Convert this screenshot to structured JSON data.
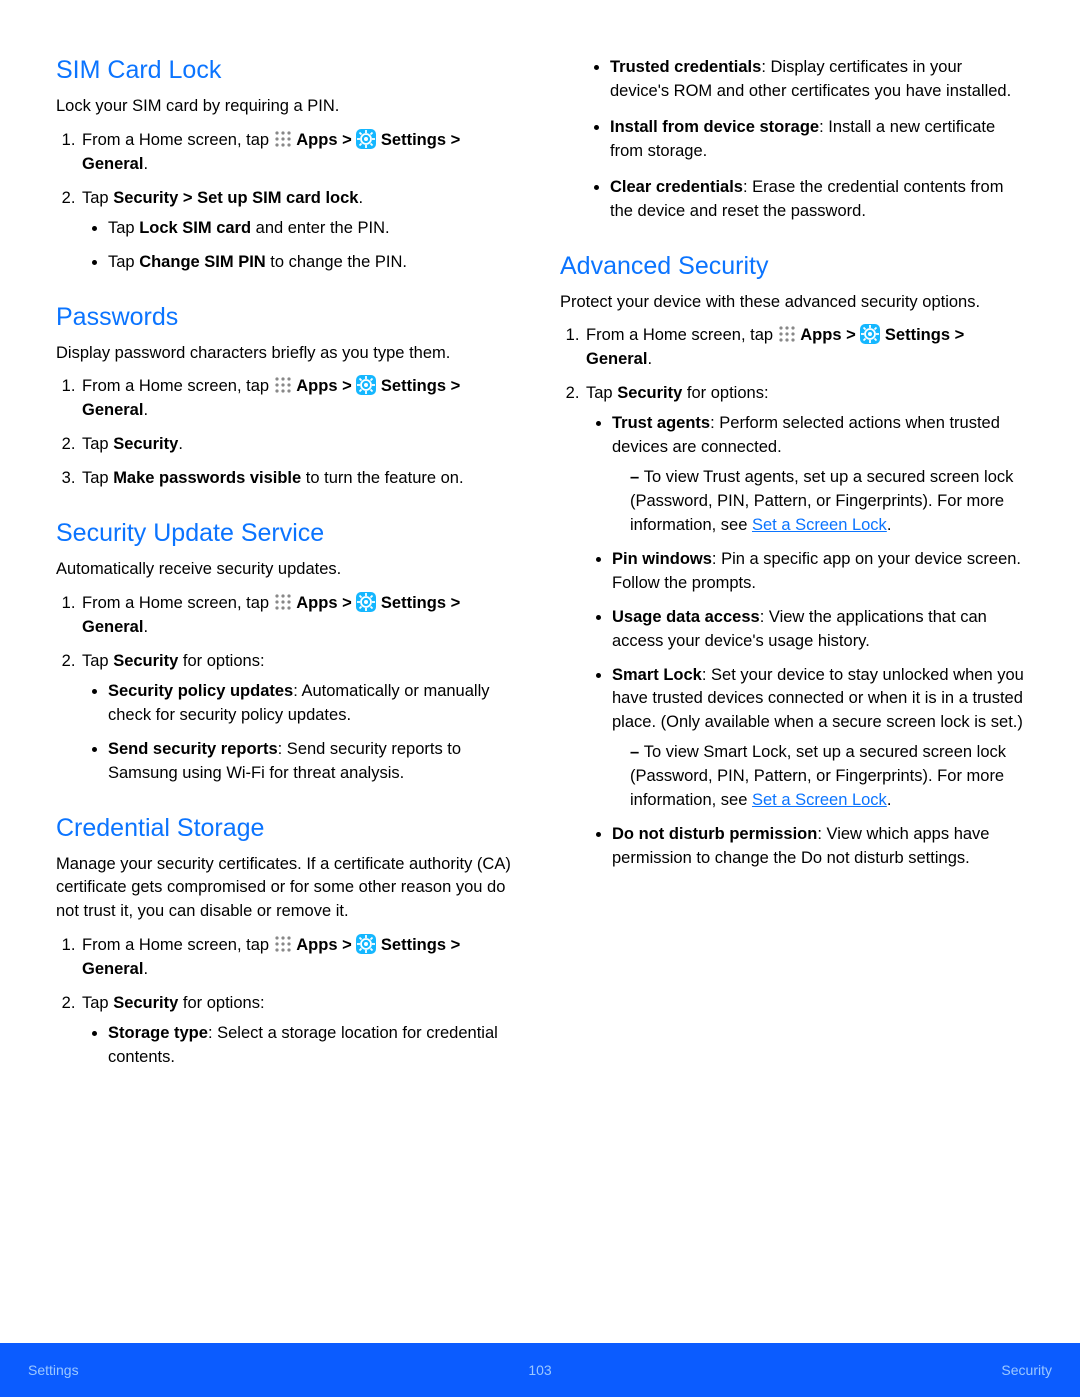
{
  "icons": {
    "apps": "apps-icon",
    "settings": "settings-icon"
  },
  "nav": {
    "apps": "Apps",
    "settings": "Settings",
    "general": "General",
    "security": "Security"
  },
  "left": {
    "sim": {
      "heading": "SIM Card Lock",
      "intro": "Lock your SIM card by requiring a PIN.",
      "step1_a": "From a Home screen, tap ",
      "step1_b": " > ",
      "step1_c": " > ",
      "step1_d": ".",
      "step2_a": "Tap ",
      "step2_b": "Security > Set up SIM card lock",
      "step2_c": ".",
      "b1_a": "Tap ",
      "b1_b": "Lock SIM card",
      "b1_c": " and enter the PIN.",
      "b2_a": "Tap ",
      "b2_b": "Change SIM PIN",
      "b2_c": " to change the PIN."
    },
    "pw": {
      "heading": "Passwords",
      "intro": "Display password characters briefly as you type them.",
      "step2_a": "Tap ",
      "step2_b": "Security",
      "step2_c": ".",
      "step3_a": "Tap ",
      "step3_b": "Make passwords visible",
      "step3_c": " to turn the feature on."
    },
    "sus": {
      "heading": "Security Update Service",
      "intro": "Automatically receive security updates.",
      "step2_a": "Tap ",
      "step2_b": "Security",
      "step2_c": " for options:",
      "b1_b": "Security policy updates",
      "b1_c": ": Automatically or manually check for security policy updates.",
      "b2_b": "Send security reports",
      "b2_c": ": Send security reports to Samsung using Wi-Fi for threat analysis."
    },
    "cred": {
      "heading": "Credential Storage",
      "intro": "Manage your security certificates. If a certificate authority (CA) certificate gets compromised or for some other reason you do not trust it, you can disable or remove it.",
      "step2_a": "Tap ",
      "step2_b": "Security",
      "step2_c": " for options:",
      "b1_b": "Storage type",
      "b1_c": ": Select a storage location for credential contents."
    }
  },
  "right": {
    "cont": {
      "b1_b": "Trusted credentials",
      "b1_c": ": Display certificates in your device's ROM and other certificates you have installed.",
      "b2_b": "Install from device storage",
      "b2_c": ": Install a new certificate from storage.",
      "b3_b": "Clear credentials",
      "b3_c": ": Erase the credential contents from the device and reset the password."
    },
    "adv": {
      "heading": "Advanced Security",
      "intro": "Protect your device with these advanced security options.",
      "step2_a": "Tap ",
      "step2_b": "Security",
      "step2_c": " for options:",
      "b1_b": "Trust agents",
      "b1_c": ": Perform selected actions when trusted devices are connected.",
      "b1_sub_a": "To view Trust agents, set up a secured screen lock (Password, PIN, Pattern, or Fingerprints). For more information, see ",
      "b1_sub_link": "Set a Screen Lock",
      "b1_sub_c": ".",
      "b2_b": "Pin windows",
      "b2_c": ": Pin a specific app on your device screen. Follow the prompts.",
      "b3_b": "Usage data access",
      "b3_c": ": View the applications that can access your device's usage history.",
      "b4_b": "Smart Lock",
      "b4_c": ": Set your device to stay unlocked when you have trusted devices connected or when it is in a trusted place. (Only available when a secure screen lock is set.)",
      "b4_sub_a": "To view Smart Lock, set up a secured screen lock (Password, PIN, Pattern, or Fingerprints). For more information, see ",
      "b4_sub_link": "Set a Screen Lock",
      "b4_sub_c": ".",
      "b5_b": "Do not disturb permission",
      "b5_c": ": View which apps have permission to change the Do not disturb settings."
    }
  },
  "footer": {
    "left": "Settings",
    "center": "103",
    "right": "Security"
  }
}
